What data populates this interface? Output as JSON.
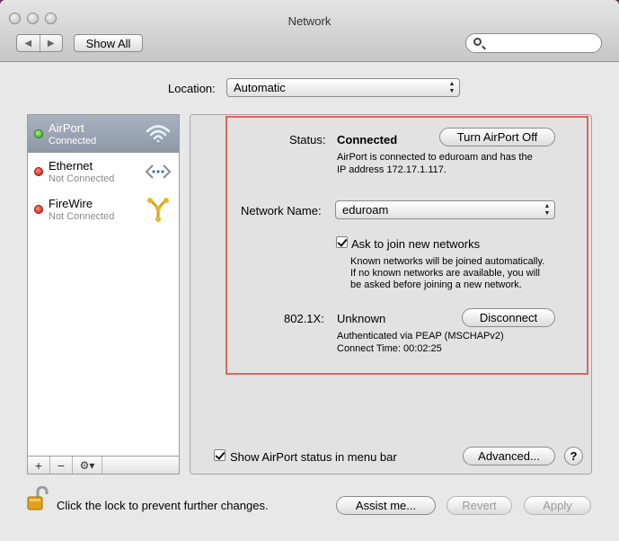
{
  "window": {
    "title": "Network"
  },
  "toolbar": {
    "back_label": "◀",
    "forward_label": "▶",
    "show_all_label": "Show All",
    "search_placeholder": ""
  },
  "location": {
    "label": "Location:",
    "value": "Automatic"
  },
  "services": [
    {
      "name": "AirPort",
      "status": "Connected",
      "indicator": "green",
      "icon": "wifi-icon",
      "selected": true
    },
    {
      "name": "Ethernet",
      "status": "Not Connected",
      "indicator": "red",
      "icon": "ethernet-icon",
      "selected": false
    },
    {
      "name": "FireWire",
      "status": "Not Connected",
      "indicator": "red",
      "icon": "firewire-icon",
      "selected": false
    }
  ],
  "sidebar_controls": {
    "add": "+",
    "remove": "−",
    "gear": "⚙▾"
  },
  "detail": {
    "status_label": "Status:",
    "status_value": "Connected",
    "turn_off_label": "Turn AirPort Off",
    "status_desc_1": "AirPort is connected to eduroam and has the",
    "status_desc_2": "IP address 172.17.1.117.",
    "network_name_label": "Network Name:",
    "network_name_value": "eduroam",
    "ask_join_label": "Ask to join new networks",
    "ask_join_checked": true,
    "ask_desc_1": "Known networks will be joined automatically.",
    "ask_desc_2": "If no known networks are available, you will",
    "ask_desc_3": "be asked before joining a new network.",
    "dot1x_label": "802.1X:",
    "dot1x_value": "Unknown",
    "disconnect_label": "Disconnect",
    "dot1x_desc_1": "Authenticated via PEAP (MSCHAPv2)",
    "dot1x_desc_2": "Connect Time: 00:02:25",
    "show_status_label": "Show AirPort status in menu bar",
    "show_status_checked": true,
    "advanced_label": "Advanced...",
    "help_label": "?"
  },
  "footer": {
    "lock_text": "Click the lock to prevent further changes.",
    "assist_label": "Assist me...",
    "revert_label": "Revert",
    "apply_label": "Apply"
  },
  "colors": {
    "highlight_box": "#e0645a",
    "connected": "#2f9b10",
    "not_connected": "#c81405"
  }
}
